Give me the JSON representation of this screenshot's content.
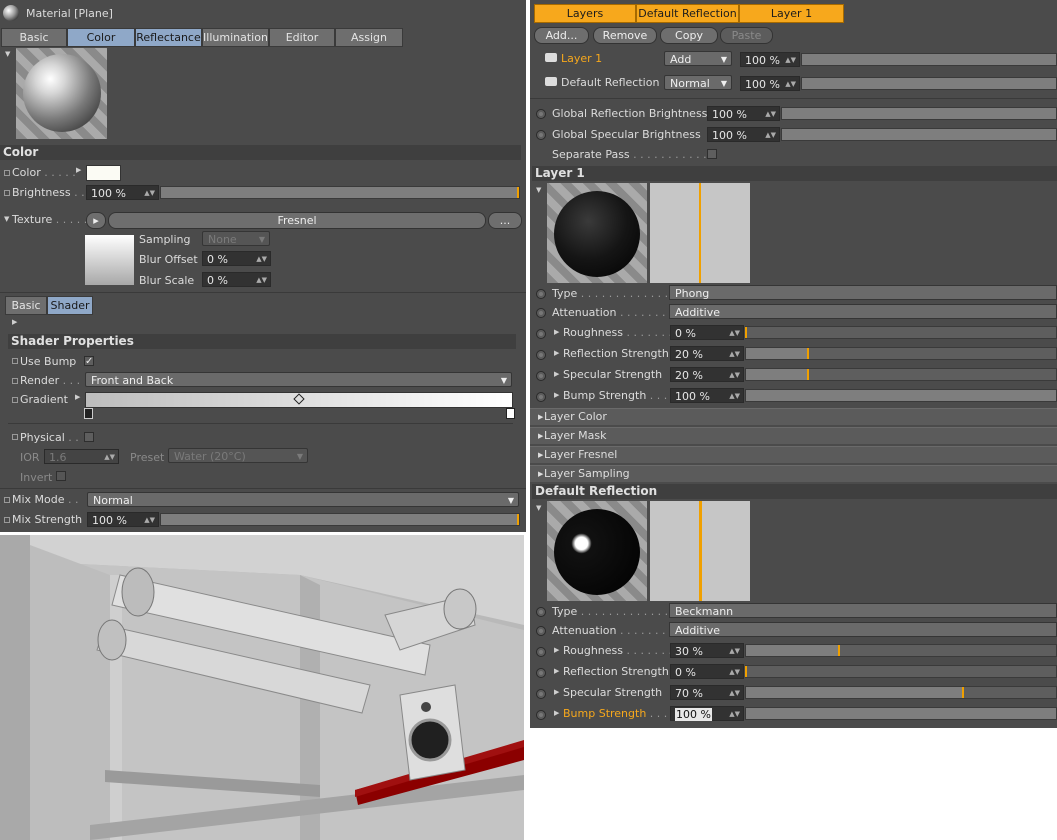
{
  "left_panel": {
    "title": "Material [Plane]",
    "tabs": [
      {
        "label": "Basic",
        "selected": false
      },
      {
        "label": "Color",
        "selected": true
      },
      {
        "label": "Reflectance",
        "selected": true
      },
      {
        "label": "Illumination",
        "selected": false
      },
      {
        "label": "Editor",
        "selected": false
      },
      {
        "label": "Assign",
        "selected": false
      }
    ],
    "color_section": {
      "heading": "Color",
      "color_label": "Color",
      "color_swatch": "#fbfbf4",
      "brightness_label": "Brightness",
      "brightness_value": "100 %",
      "brightness_level": 1.0,
      "texture_label": "Texture",
      "texture_name": "Fresnel",
      "texture_more": "...",
      "sampling_label": "Sampling",
      "sampling_value": "None",
      "blur_offset_label": "Blur Offset",
      "blur_offset_value": "0 %",
      "blur_scale_label": "Blur Scale",
      "blur_scale_value": "0 %"
    },
    "shader_tabs": [
      {
        "label": "Basic",
        "selected": false
      },
      {
        "label": "Shader",
        "selected": true
      }
    ],
    "shader_properties": {
      "heading": "Shader Properties",
      "use_bump_label": "Use Bump",
      "use_bump_checked": "✓",
      "render_label": "Render",
      "render_value": "Front and Back",
      "gradient_label": "Gradient",
      "physical_label": "Physical",
      "ior_label": "IOR",
      "ior_value": "1.6",
      "preset_label": "Preset",
      "preset_value": "Water (20°C)",
      "invert_label": "Invert"
    },
    "mix_mode_label": "Mix Mode",
    "mix_mode_value": "Normal",
    "mix_strength_label": "Mix Strength",
    "mix_strength_value": "100 %",
    "mix_strength_level": 1.0
  },
  "right_panel": {
    "top_tabs": [
      "Layers",
      "Default Reflection",
      "Layer 1"
    ],
    "buttons": {
      "add": "Add...",
      "remove": "Remove",
      "copy": "Copy",
      "paste": "Paste"
    },
    "layers": [
      {
        "name": "Layer 1",
        "blend": "Add",
        "amount": "100 %",
        "active": true
      },
      {
        "name": "Default Reflection",
        "blend": "Normal",
        "amount": "100 %",
        "active": false
      }
    ],
    "global_reflection_label": "Global Reflection Brightness",
    "global_reflection_value": "100 %",
    "global_specular_label": "Global Specular Brightness",
    "global_specular_value": "100 %",
    "separate_pass_label": "Separate Pass",
    "layer1": {
      "heading": "Layer 1",
      "type_label": "Type",
      "type_value": "Phong",
      "attenuation_label": "Attenuation",
      "attenuation_value": "Additive",
      "params": [
        {
          "label": "Roughness",
          "value": "0 %",
          "level": 0.0
        },
        {
          "label": "Reflection Strength",
          "value": "20 %",
          "level": 0.2
        },
        {
          "label": "Specular Strength",
          "value": "20 %",
          "level": 0.2
        },
        {
          "label": "Bump Strength",
          "value": "100 %",
          "level": 1.0
        }
      ],
      "groups": [
        "Layer Color",
        "Layer Mask",
        "Layer Fresnel",
        "Layer Sampling"
      ]
    },
    "default_reflection": {
      "heading": "Default Reflection",
      "type_label": "Type",
      "type_value": "Beckmann",
      "attenuation_label": "Attenuation",
      "attenuation_value": "Additive",
      "params": [
        {
          "label": "Roughness",
          "value": "30 %",
          "level": 0.3
        },
        {
          "label": "Reflection Strength",
          "value": "0 %",
          "level": 0.0
        },
        {
          "label": "Specular Strength",
          "value": "70 %",
          "level": 0.7
        },
        {
          "label": "Bump Strength",
          "value": "100 %",
          "level": 1.0,
          "highlighted": true
        }
      ]
    }
  },
  "colors": {
    "accent": "#f7a81c",
    "tab_selected": "#8fa8c8",
    "panel": "#4b4b4b"
  }
}
